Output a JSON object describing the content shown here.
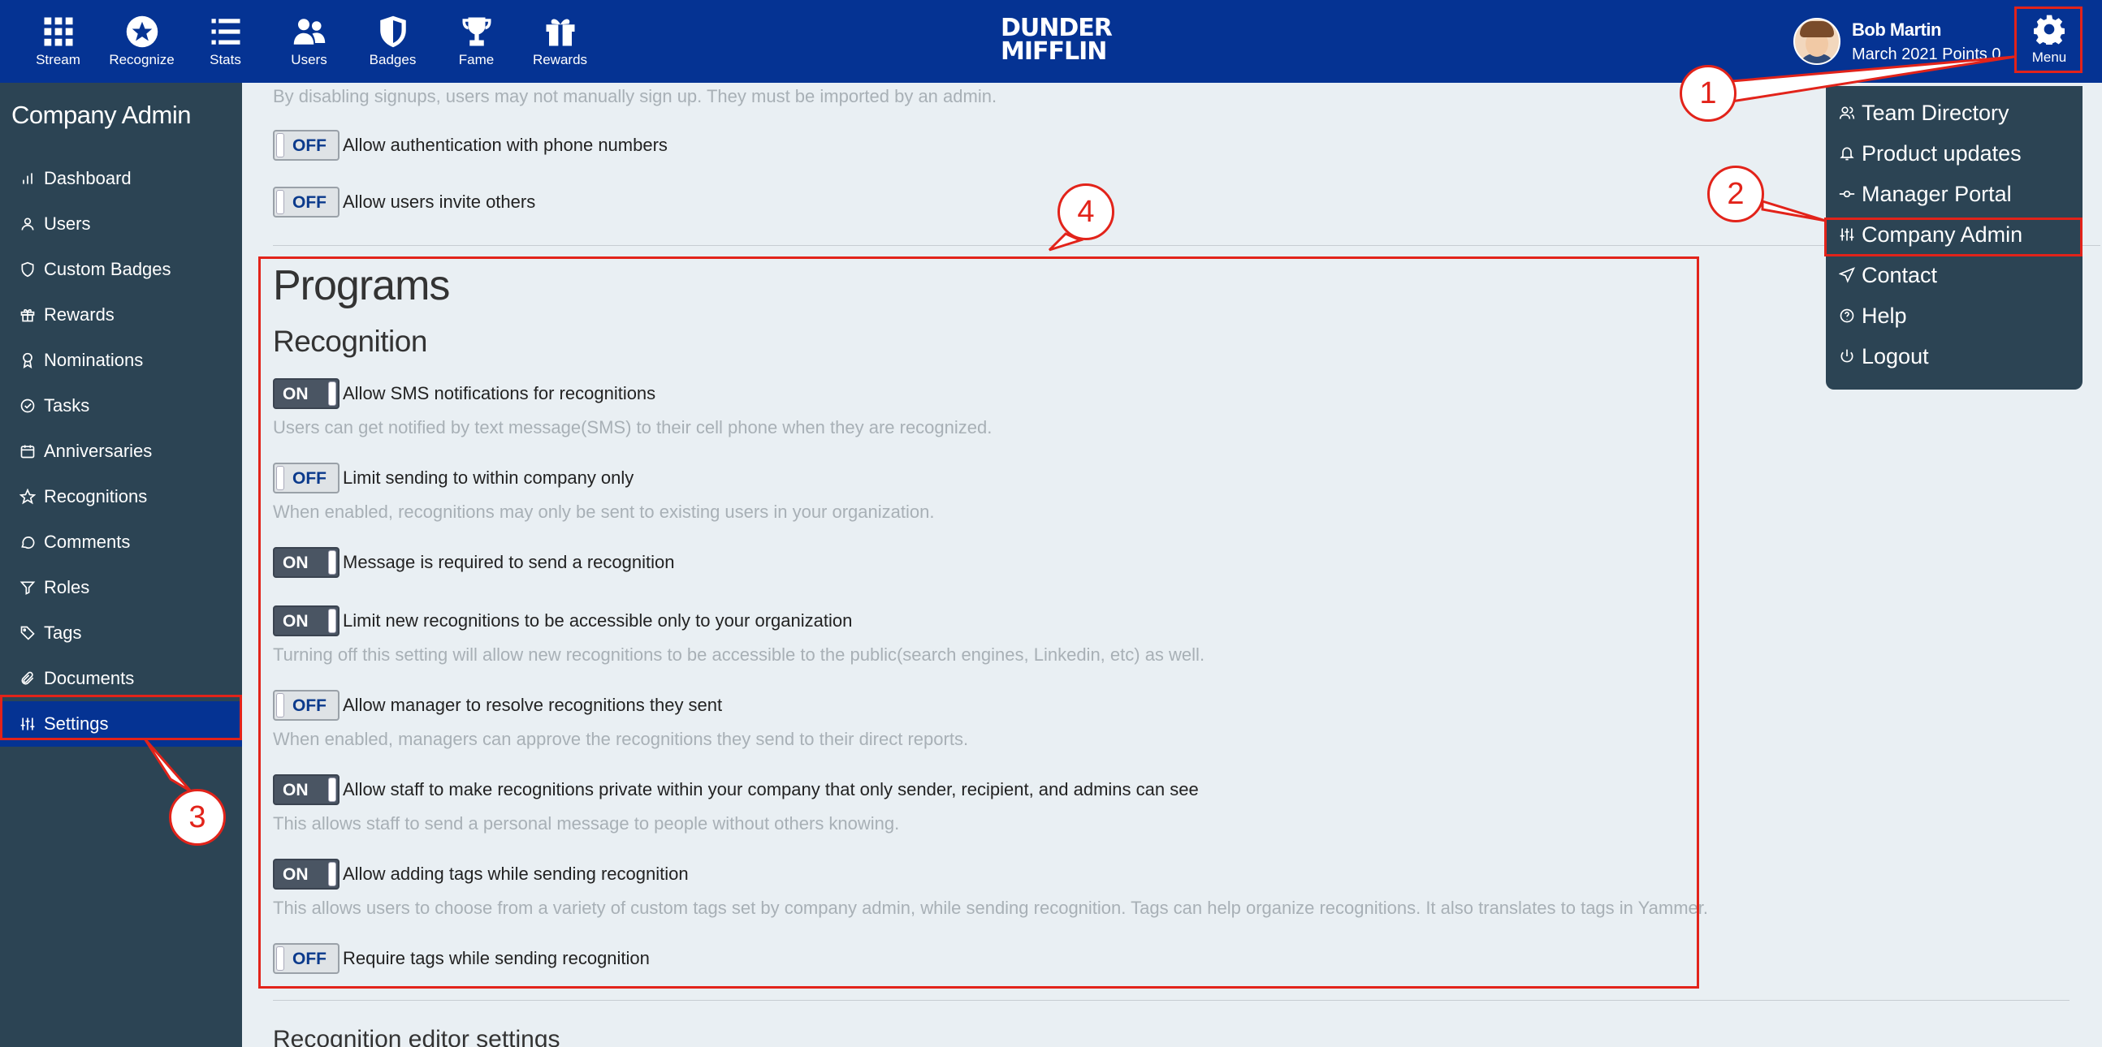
{
  "topnav": [
    {
      "label": "Stream",
      "icon": "grid-icon"
    },
    {
      "label": "Recognize",
      "icon": "star-circle-icon"
    },
    {
      "label": "Stats",
      "icon": "list-icon"
    },
    {
      "label": "Users",
      "icon": "users-icon"
    },
    {
      "label": "Badges",
      "icon": "shield-icon"
    },
    {
      "label": "Fame",
      "icon": "trophy-icon"
    },
    {
      "label": "Rewards",
      "icon": "gift-icon"
    }
  ],
  "logo": {
    "line1": "DUNDER",
    "line2": "MIFFLIN"
  },
  "user": {
    "name": "Bob Martin",
    "points": "March 2021 Points 0"
  },
  "menu": {
    "label": "Menu"
  },
  "sidebar": {
    "title": "Company Admin",
    "items": [
      {
        "label": "Dashboard",
        "icon": "bar-chart-icon"
      },
      {
        "label": "Users",
        "icon": "user-icon"
      },
      {
        "label": "Custom Badges",
        "icon": "shield-icon"
      },
      {
        "label": "Rewards",
        "icon": "gift-icon"
      },
      {
        "label": "Nominations",
        "icon": "award-icon"
      },
      {
        "label": "Tasks",
        "icon": "check-circle-icon"
      },
      {
        "label": "Anniversaries",
        "icon": "calendar-icon"
      },
      {
        "label": "Recognitions",
        "icon": "star-icon"
      },
      {
        "label": "Comments",
        "icon": "comment-icon"
      },
      {
        "label": "Roles",
        "icon": "filter-icon"
      },
      {
        "label": "Tags",
        "icon": "tag-icon"
      },
      {
        "label": "Documents",
        "icon": "paperclip-icon"
      },
      {
        "label": "Settings",
        "icon": "sliders-icon"
      }
    ]
  },
  "main": {
    "top_hint": "By disabling signups, users may not manually sign up. They must be imported by an admin.",
    "auth_phone": {
      "state": "OFF",
      "label": "Allow authentication with phone numbers"
    },
    "invite_others": {
      "state": "OFF",
      "label": "Allow users invite others"
    },
    "programs_heading": "Programs",
    "recognition_heading": "Recognition",
    "settings": [
      {
        "state": "ON",
        "label": "Allow SMS notifications for recognitions",
        "hint": "Users can get notified by text message(SMS) to their cell phone when they are recognized."
      },
      {
        "state": "OFF",
        "label": "Limit sending to within company only",
        "hint": "When enabled, recognitions may only be sent to existing users in your organization."
      },
      {
        "state": "ON",
        "label": "Message is required to send a recognition",
        "hint": ""
      },
      {
        "state": "ON",
        "label": "Limit new recognitions to be accessible only to your organization",
        "hint": "Turning off this setting will allow new recognitions to be accessible to the public(search engines, Linkedin, etc) as well."
      },
      {
        "state": "OFF",
        "label": "Allow manager to resolve recognitions they sent",
        "hint": "When enabled, managers can approve the recognitions they send to their direct reports."
      },
      {
        "state": "ON",
        "label": "Allow staff to make recognitions private within your company that only sender, recipient, and admins can see",
        "hint": "This allows staff to send a personal message to people without others knowing."
      },
      {
        "state": "ON",
        "label": "Allow adding tags while sending recognition",
        "hint": "This allows users to choose from a variety of custom tags set by company admin, while sending recognition. Tags can help organize recognitions. It also translates to tags in Yammer."
      },
      {
        "state": "OFF",
        "label": "Require tags while sending recognition",
        "hint": ""
      }
    ],
    "editor_heading": "Recognition editor settings"
  },
  "dropdown": [
    {
      "label": "Team Directory",
      "icon": "users-icon"
    },
    {
      "label": "Product updates",
      "icon": "bell-icon"
    },
    {
      "label": "Manager Portal",
      "icon": "commit-icon"
    },
    {
      "label": "Company Admin",
      "icon": "sliders-icon"
    },
    {
      "label": "Contact",
      "icon": "send-icon"
    },
    {
      "label": "Help",
      "icon": "help-circle-icon"
    },
    {
      "label": "Logout",
      "icon": "power-icon"
    }
  ],
  "annotations": {
    "b1": "1",
    "b2": "2",
    "b3": "3",
    "b4": "4"
  },
  "colors": {
    "topbar": "#053393",
    "sidebar": "#2c4454",
    "annotation": "#e2231a",
    "background": "#e9eff3"
  }
}
